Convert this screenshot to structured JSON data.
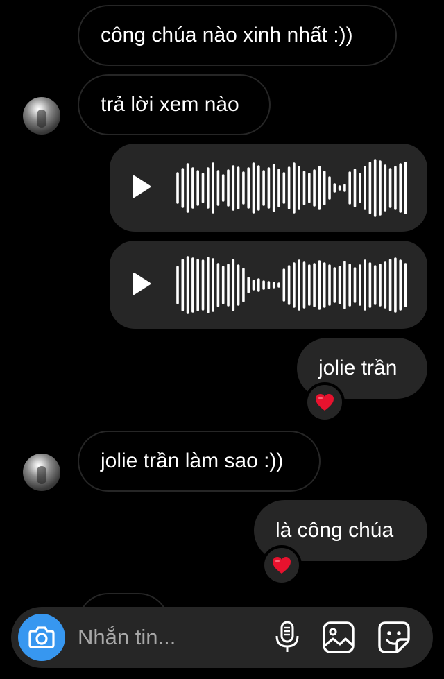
{
  "messages": [
    {
      "side": "in",
      "text": "công chúa nào xinh nhất :))"
    },
    {
      "side": "in",
      "text": "trả lời xem nào"
    },
    {
      "side": "out",
      "type": "voice"
    },
    {
      "side": "out",
      "type": "voice"
    },
    {
      "side": "out",
      "text": "jolie trần",
      "reaction": "heart"
    },
    {
      "side": "in",
      "text": "jolie trần làm sao :))"
    },
    {
      "side": "out",
      "text": "là công chúa",
      "reaction": "heart"
    }
  ],
  "composer": {
    "placeholder": "Nhắn tin...",
    "icons": [
      "camera-icon",
      "microphone-icon",
      "gallery-icon",
      "sticker-icon"
    ]
  },
  "colors": {
    "background": "#000000",
    "bubble_out": "#262626",
    "bubble_in_border": "#262626",
    "accent": "#3797f0",
    "reaction": "#e8122e"
  }
}
